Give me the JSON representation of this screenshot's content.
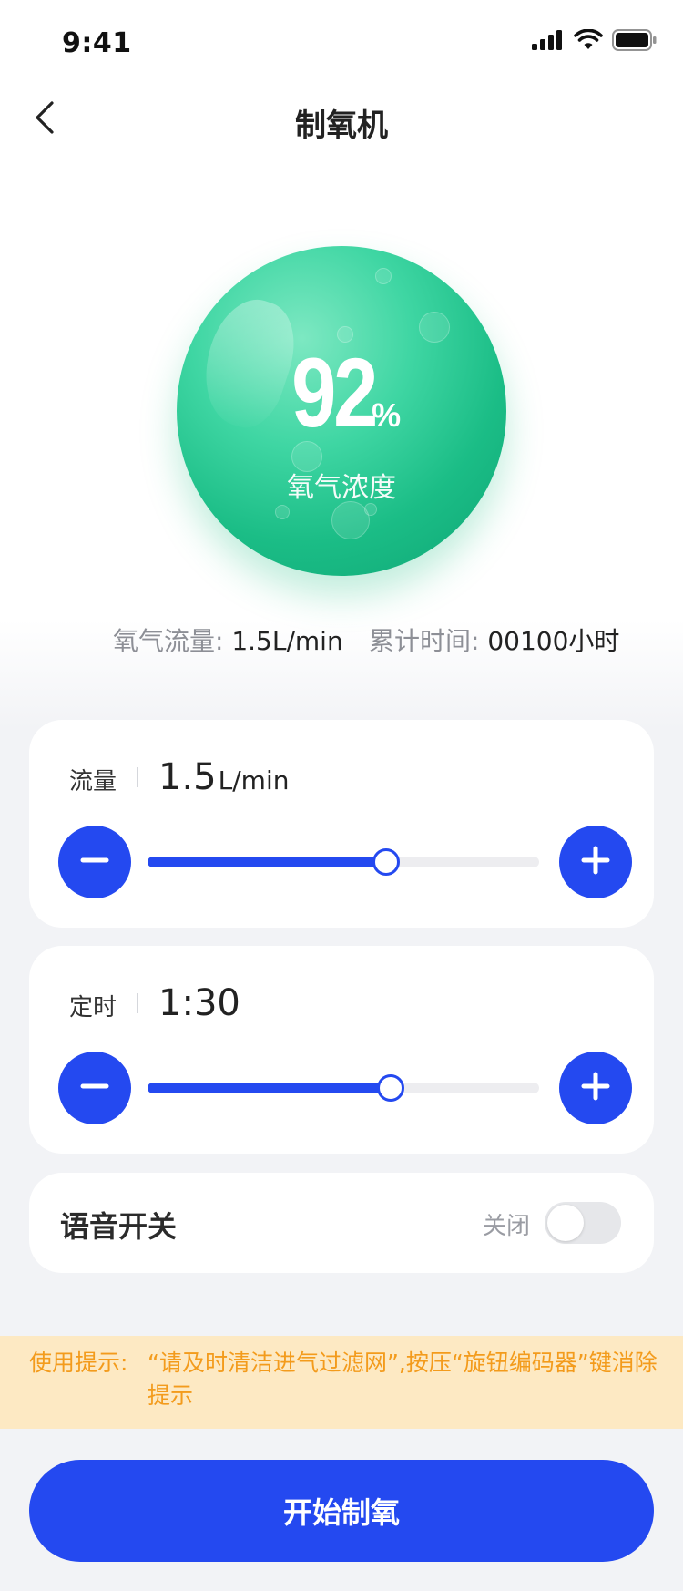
{
  "status_bar": {
    "time": "9:41"
  },
  "nav": {
    "title": "制氧机"
  },
  "oxygen": {
    "value": "92",
    "unit": "%",
    "label": "氧气浓度",
    "level": 0.92
  },
  "stats": {
    "flow_label": "氧气流量:",
    "flow_value": "1.5L/min",
    "time_label": "累计时间:",
    "time_value": "00100小时"
  },
  "flow_control": {
    "label": "流量",
    "value": "1.5",
    "unit": "L/min",
    "level": 0.61
  },
  "timer_control": {
    "label": "定时",
    "value": "1:30",
    "level": 0.62
  },
  "voice": {
    "label": "语音开关",
    "state": "关闭",
    "enabled": false
  },
  "tip": {
    "label": "使用提示:",
    "text": "“请及时清洁进气过滤网”,按压“旋钮编码器”键消除提示"
  },
  "action": {
    "start_label": "开始制氧"
  },
  "colors": {
    "primary": "#2449f0",
    "accent_green": "#1bbd86",
    "tip_bg": "#fde9c3",
    "tip_text": "#f39b1c"
  }
}
